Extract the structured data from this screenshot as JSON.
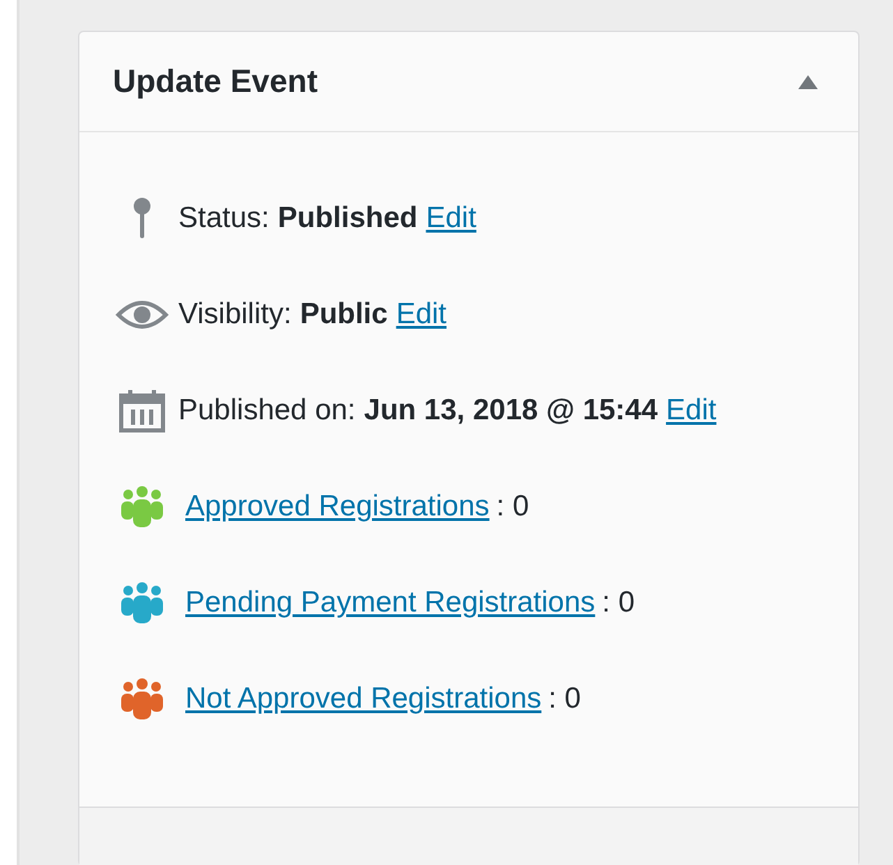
{
  "panel": {
    "title": "Update Event",
    "expanded": true
  },
  "meta": [
    {
      "kind": "status",
      "label": "Status:",
      "value": "Published",
      "link": "Edit"
    },
    {
      "kind": "visibility",
      "label": "Visibility:",
      "value": "Public",
      "link": "Edit"
    },
    {
      "kind": "date",
      "label": "Published on:",
      "value": "Jun 13, 2018 @ 15:44",
      "link": "Edit"
    }
  ],
  "registrations": [
    {
      "label": "Approved Registrations",
      "count": ": 0",
      "color": "#7ac943"
    },
    {
      "label": "Pending Payment Registrations",
      "count": ": 0",
      "color": "#27a9c9"
    },
    {
      "label": "Not Approved Registrations",
      "count": ": 0",
      "color": "#e0642a"
    }
  ]
}
